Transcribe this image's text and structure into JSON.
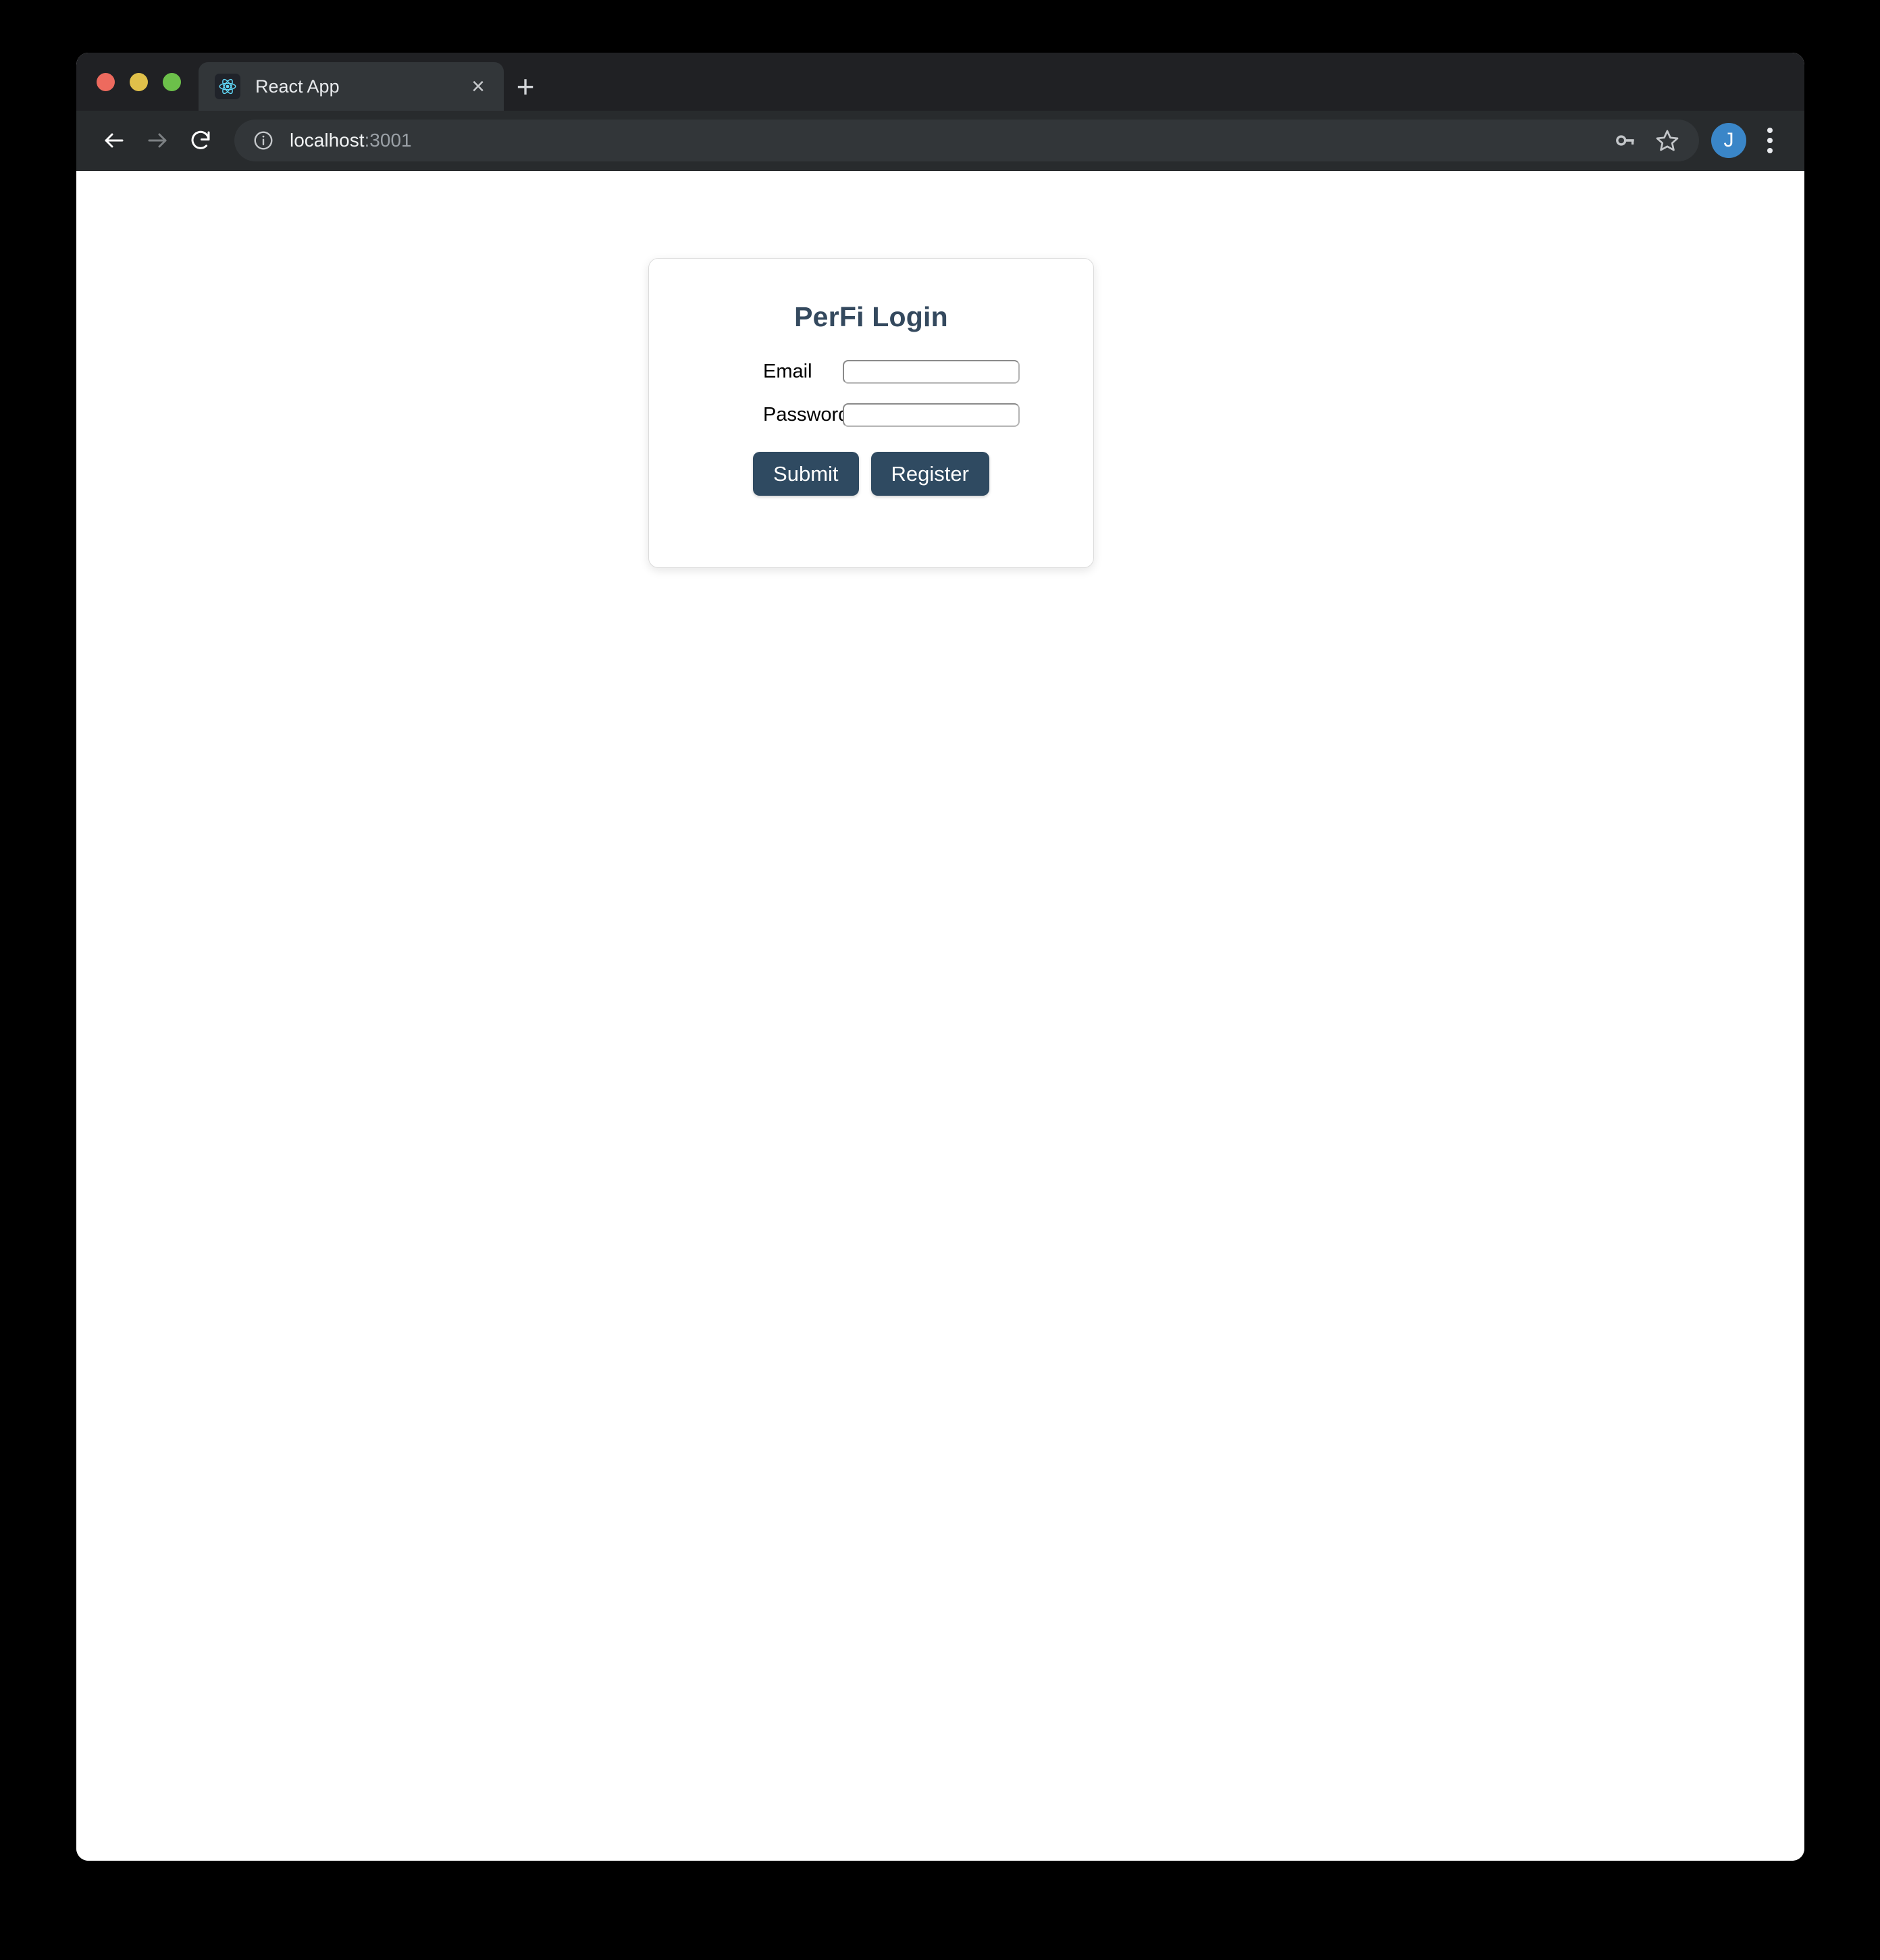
{
  "browser": {
    "traffic_lights": [
      {
        "name": "close",
        "color": "#ed6a5e"
      },
      {
        "name": "minimize",
        "color": "#e0c04a"
      },
      {
        "name": "maximize",
        "color": "#6cc04a"
      }
    ],
    "tab": {
      "title": "React App",
      "favicon": "react-logo-icon",
      "close_label": "×"
    },
    "new_tab_label": "+",
    "nav": {
      "back_icon": "back-arrow-icon",
      "forward_icon": "forward-arrow-icon",
      "reload_icon": "reload-icon"
    },
    "omnibox": {
      "site_info_icon": "info-circle-icon",
      "url_host": "localhost",
      "url_suffix": ":3001",
      "full_url": "localhost:3001",
      "password_icon": "key-icon",
      "bookmark_icon": "star-outline-icon"
    },
    "profile": {
      "initial": "J",
      "color": "#3a86c8"
    },
    "menu_icon": "three-dot-menu-icon"
  },
  "page": {
    "card": {
      "title": "PerFi Login",
      "title_color": "#34495e",
      "fields": [
        {
          "label": "Email",
          "value": "",
          "placeholder": "",
          "type": "text",
          "name": "email"
        },
        {
          "label": "Password",
          "value": "",
          "placeholder": "",
          "type": "password",
          "name": "password"
        }
      ],
      "buttons": [
        {
          "label": "Submit",
          "name": "submit"
        },
        {
          "label": "Register",
          "name": "register"
        }
      ],
      "button_color": "#2f4a61"
    }
  }
}
